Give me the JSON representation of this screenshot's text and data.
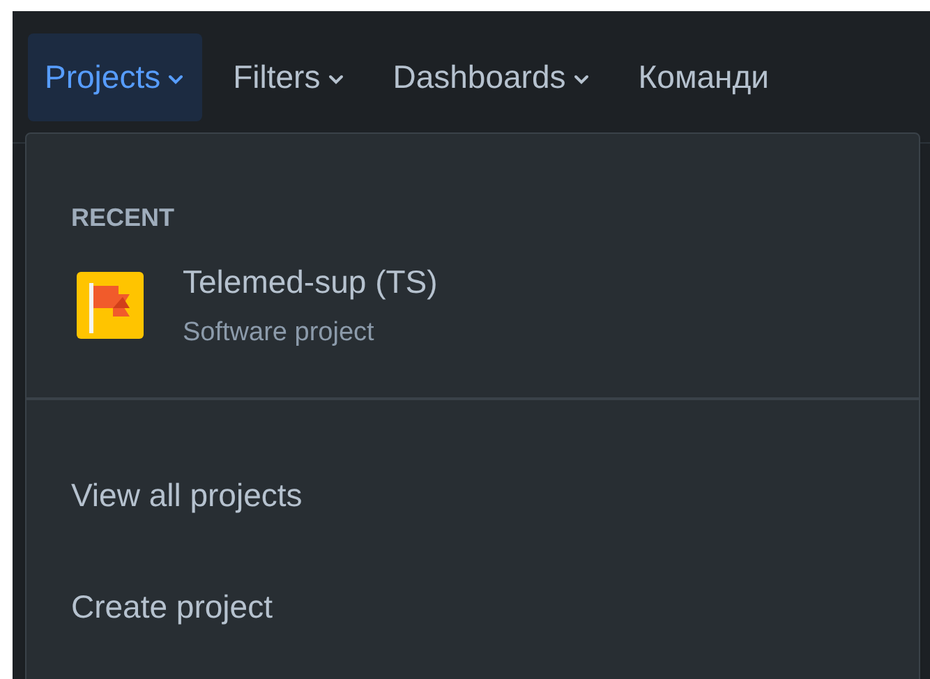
{
  "nav": [
    {
      "label": "Projects",
      "selected": true,
      "has_menu": true
    },
    {
      "label": "Filters",
      "selected": false,
      "has_menu": true
    },
    {
      "label": "Dashboards",
      "selected": false,
      "has_menu": true
    },
    {
      "label": "Команди",
      "selected": false,
      "has_menu": false
    }
  ],
  "dropdown": {
    "section_title": "RECENT",
    "recent": [
      {
        "name": "Telemed-sup (TS)",
        "type": "Software project"
      }
    ],
    "actions": [
      "View all projects",
      "Create project"
    ]
  }
}
